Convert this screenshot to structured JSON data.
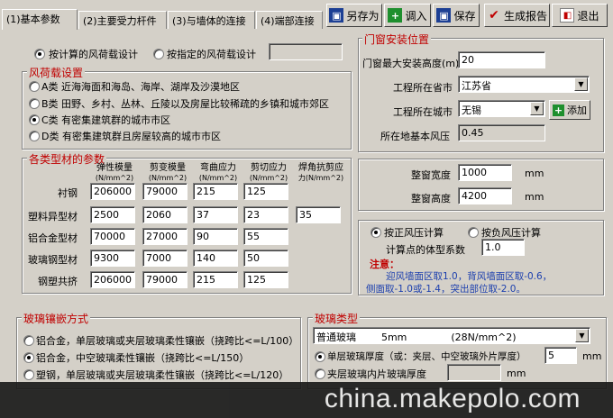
{
  "tabs": [
    "(1)基本参数",
    "(2)主要受力杆件",
    "(3)与墙体的连接",
    "(4)端部连接"
  ],
  "toolbar": {
    "save_as": "另存为",
    "import": "调入",
    "save": "保存",
    "report": "生成报告",
    "exit": "退出"
  },
  "load_mode": {
    "computed": "按计算的风荷载设计",
    "specified": "按指定的风荷载设计",
    "specified_value": ""
  },
  "wind": {
    "title": "风荷载设置",
    "options": [
      "A类  近海海面和海岛、海岸、湖岸及沙漠地区",
      "B类  田野、乡村、丛林、丘陵以及房屋比较稀疏的乡镇和城市郊区",
      "C类  有密集建筑群的城市市区",
      "D类  有密集建筑群且房屋较高的城市市区"
    ],
    "selected": 2
  },
  "install": {
    "title": "门窗安装位置",
    "height_label": "门窗最大安装高度(m)",
    "height_value": "20",
    "province_label": "工程所在省市",
    "province_value": "江苏省",
    "city_label": "工程所在城市",
    "city_value": "无锡",
    "add_label": "添加",
    "pressure_label": "所在地基本风压",
    "pressure_value": "0.45"
  },
  "materials": {
    "title": "各类型材的参数",
    "headers": [
      {
        "name": "弹性模量",
        "unit": "(N/mm^2)"
      },
      {
        "name": "剪变模量",
        "unit": "(N/mm^2)"
      },
      {
        "name": "弯曲应力",
        "unit": "(N/mm^2)"
      },
      {
        "name": "剪切应力",
        "unit": "(N/mm^2)"
      },
      {
        "name": "焊角抗剪应",
        "unit": "力(N/mm^2)"
      }
    ],
    "rows": [
      {
        "name": "衬钢",
        "values": [
          "206000",
          "79000",
          "215",
          "125",
          ""
        ]
      },
      {
        "name": "塑料异型材",
        "values": [
          "2500",
          "2060",
          "37",
          "23",
          "35"
        ]
      },
      {
        "name": "铝合金型材",
        "values": [
          "70000",
          "27000",
          "90",
          "55",
          ""
        ]
      },
      {
        "name": "玻璃钢型材",
        "values": [
          "9300",
          "7000",
          "140",
          "50",
          ""
        ]
      },
      {
        "name": "钢塑共挤",
        "values": [
          "206000",
          "79000",
          "215",
          "125",
          ""
        ]
      }
    ]
  },
  "dims": {
    "width_label": "整窗宽度",
    "width_value": "1000",
    "width_unit": "mm",
    "height_label": "整窗高度",
    "height_value": "4200",
    "height_unit": "mm"
  },
  "pressure_calc": {
    "positive": "按正风压计算",
    "negative": "按负风压计算",
    "coef_label": "计算点的体型系数",
    "coef_value": "1.0",
    "note_title": "注意：",
    "note_line1": "迎风墙面区取1.0，背风墙面区取-0.6，",
    "note_line2": "侧面取-1.0或-1.4，突出部位取-2.0。"
  },
  "glazing": {
    "title": "玻璃镶嵌方式",
    "options": [
      "铝合金，单层玻璃或夹层玻璃柔性镶嵌（挠跨比<=L/100）",
      "铝合金，中空玻璃柔性镶嵌（挠跨比<=L/150）",
      "塑钢，单层玻璃或夹层玻璃柔性镶嵌（挠跨比<=L/120）"
    ],
    "selected": 1
  },
  "glass": {
    "title": "玻璃类型",
    "type_value": "普通玻璃        5mm              (28N/mm^2)",
    "single_label": "单层玻璃厚度（或：夹层、中空玻璃外片厚度）",
    "single_value": "5",
    "inner_label": "夹层玻璃内片玻璃厚度",
    "inner_value": "",
    "unit": "mm"
  },
  "watermark": "china.makepolo.com",
  "colors": {
    "group_title": "#c00000",
    "face": "#d4d0c8",
    "save_as_icon": "#1c3f94",
    "import_icon": "#1e8f2e",
    "report_icon": "#c00000"
  },
  "icons": [
    "save-disk-icon",
    "green-plus-icon",
    "save-disk-icon",
    "check-icon",
    "exit-door-icon",
    "green-plus-icon"
  ]
}
